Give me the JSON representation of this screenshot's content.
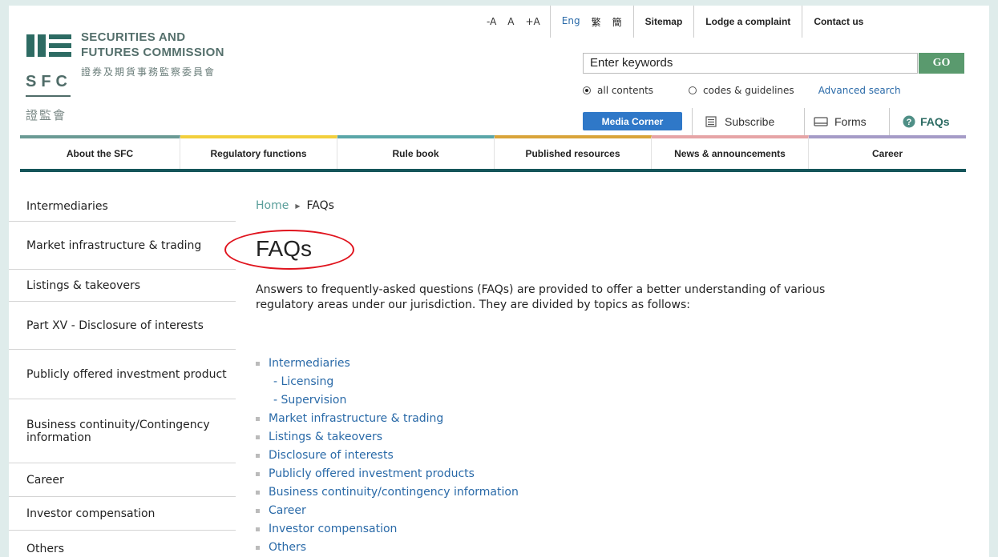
{
  "logo": {
    "en_line1": "SECURITIES AND",
    "en_line2": "FUTURES COMMISSION",
    "cn_full": "證券及期貨事務監察委員會",
    "abbr": "SFC",
    "cn_abbr": "證監會",
    "color": "#2d6b63"
  },
  "utility": {
    "font_small": "-A",
    "font_normal": "A",
    "font_large": "+A",
    "lang_en": "Eng",
    "lang_tc": "繁",
    "lang_sc": "簡",
    "sitemap": "Sitemap",
    "complaint": "Lodge a complaint",
    "contact": "Contact us"
  },
  "search": {
    "value": "Enter keywords",
    "go": "GO",
    "option_all": "all contents",
    "option_codes": "codes & guidelines",
    "advanced": "Advanced search"
  },
  "quick": {
    "media": "Media Corner",
    "subscribe": "Subscribe",
    "forms": "Forms",
    "faqs": "FAQs"
  },
  "nav": [
    {
      "label": "About the SFC",
      "color": "#6a9a94"
    },
    {
      "label": "Regulatory functions",
      "color": "#f2cf3c"
    },
    {
      "label": "Rule book",
      "color": "#5aa6a8"
    },
    {
      "label": "Published resources",
      "color": "#d9a43a"
    },
    {
      "label": "News & announcements",
      "color": "#e6a4a6"
    },
    {
      "label": "Career",
      "color": "#a59bc7"
    }
  ],
  "sidebar": [
    "Intermediaries",
    "Market infrastructure & trading",
    "Listings & takeovers",
    "Part XV - Disclosure of interests",
    "Publicly offered investment product",
    "Business continuity/Contingency information",
    "Career",
    "Investor compensation",
    "Others"
  ],
  "breadcrumb": {
    "home": "Home",
    "current": "FAQs"
  },
  "title": "FAQs",
  "intro": "Answers to frequently-asked questions (FAQs) are provided to offer a better understanding of various regulatory areas under our jurisdiction. They are divided by topics as follows:",
  "topics": {
    "t1": "Intermediaries",
    "t1_sub1": "- Licensing",
    "t1_sub2": "- Supervision",
    "t2": "Market infrastructure & trading",
    "t3": "Listings & takeovers",
    "t4": "Disclosure of interests",
    "t5": "Publicly offered investment products",
    "t6": "Business continuity/contingency information",
    "t7": "Career",
    "t8": "Investor compensation",
    "t9": "Others"
  }
}
